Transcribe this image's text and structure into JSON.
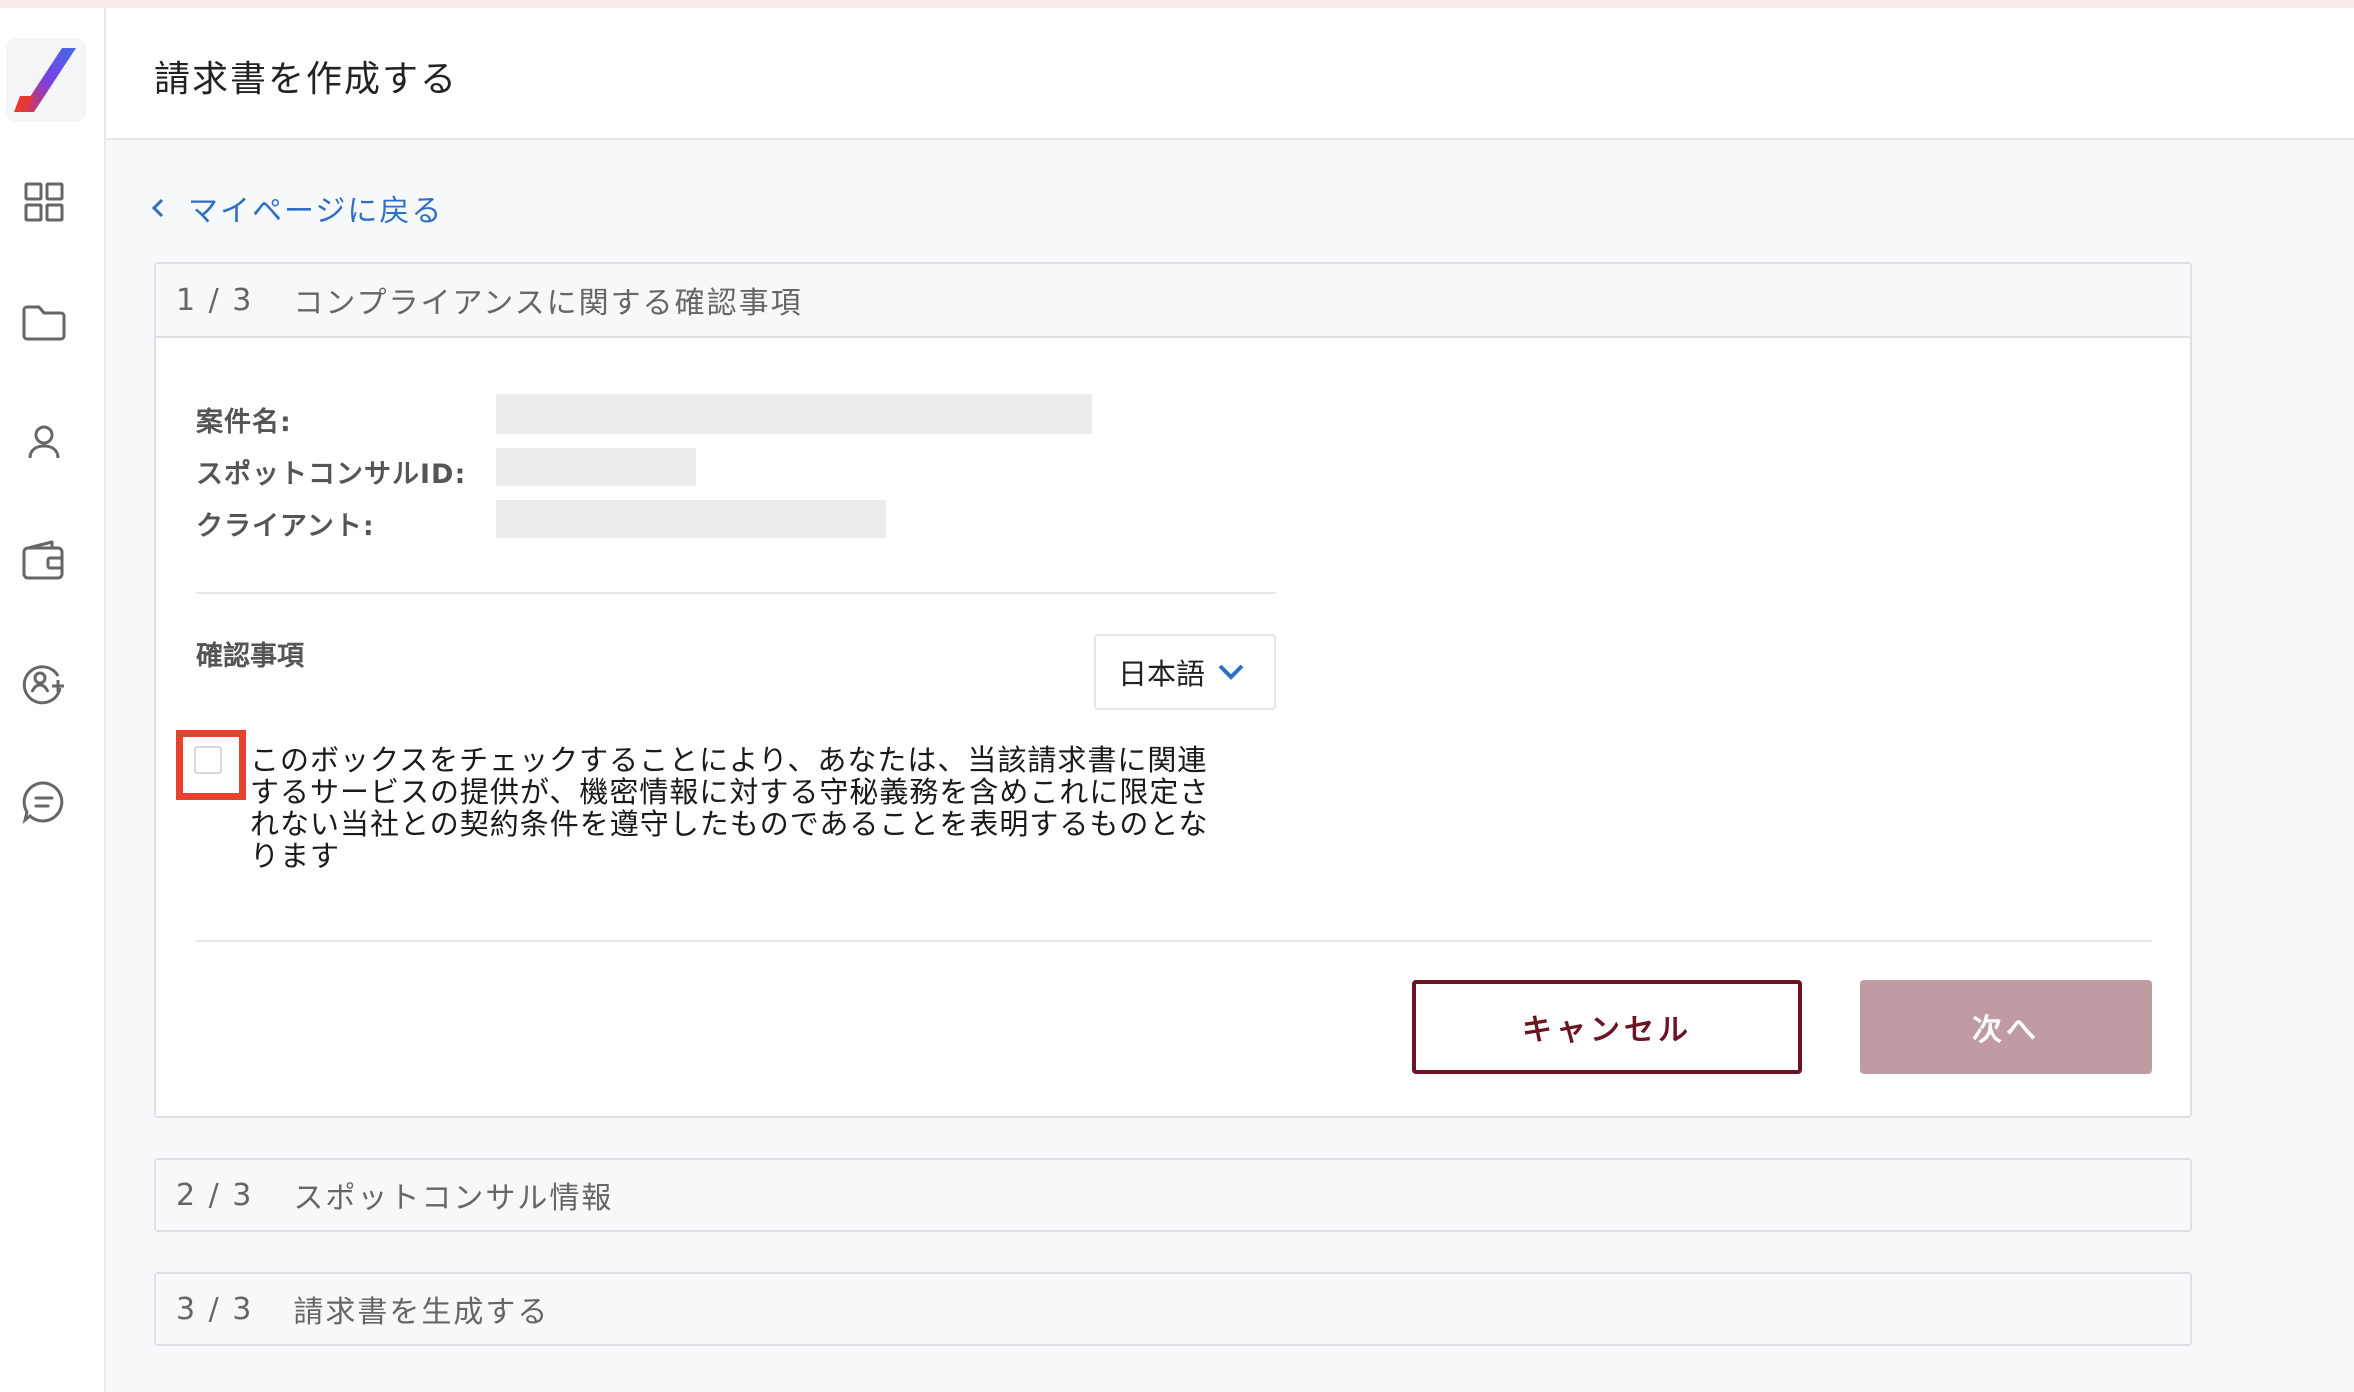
{
  "header": {
    "title": "請求書を作成する"
  },
  "sidebar": {
    "icons": [
      "app-logo",
      "dashboard-grid-icon",
      "folder-icon",
      "user-icon",
      "wallet-icon",
      "add-user-icon",
      "chat-icon"
    ]
  },
  "back_link": {
    "label": "マイページに戻る"
  },
  "steps": [
    {
      "num": "1 / 3",
      "title": "コンプライアンスに関する確認事項"
    },
    {
      "num": "2 / 3",
      "title": "スポットコンサル情報"
    },
    {
      "num": "3 / 3",
      "title": "請求書を生成する"
    }
  ],
  "project": {
    "name_label": "案件名:",
    "spot_id_label": "スポットコンサルID:",
    "client_label": "クライアント:"
  },
  "confirmation": {
    "label": "確認事項",
    "language": "日本語",
    "consent_lines": [
      "このボックスをチェックすることにより、あなたは、当該請求書に関連",
      "するサービスの提供が、機密情報に対する守秘義務を含めこれに限定さ",
      "れない当社との契約条件を遵守したものであることを表明するものとな",
      "ります"
    ],
    "checked": false
  },
  "buttons": {
    "cancel": "キャンセル",
    "next": "次へ"
  },
  "colors": {
    "link": "#2d6fc4",
    "highlight": "#e8412f",
    "cancel_border": "#6b1524",
    "next_disabled": "#c09ba2"
  }
}
